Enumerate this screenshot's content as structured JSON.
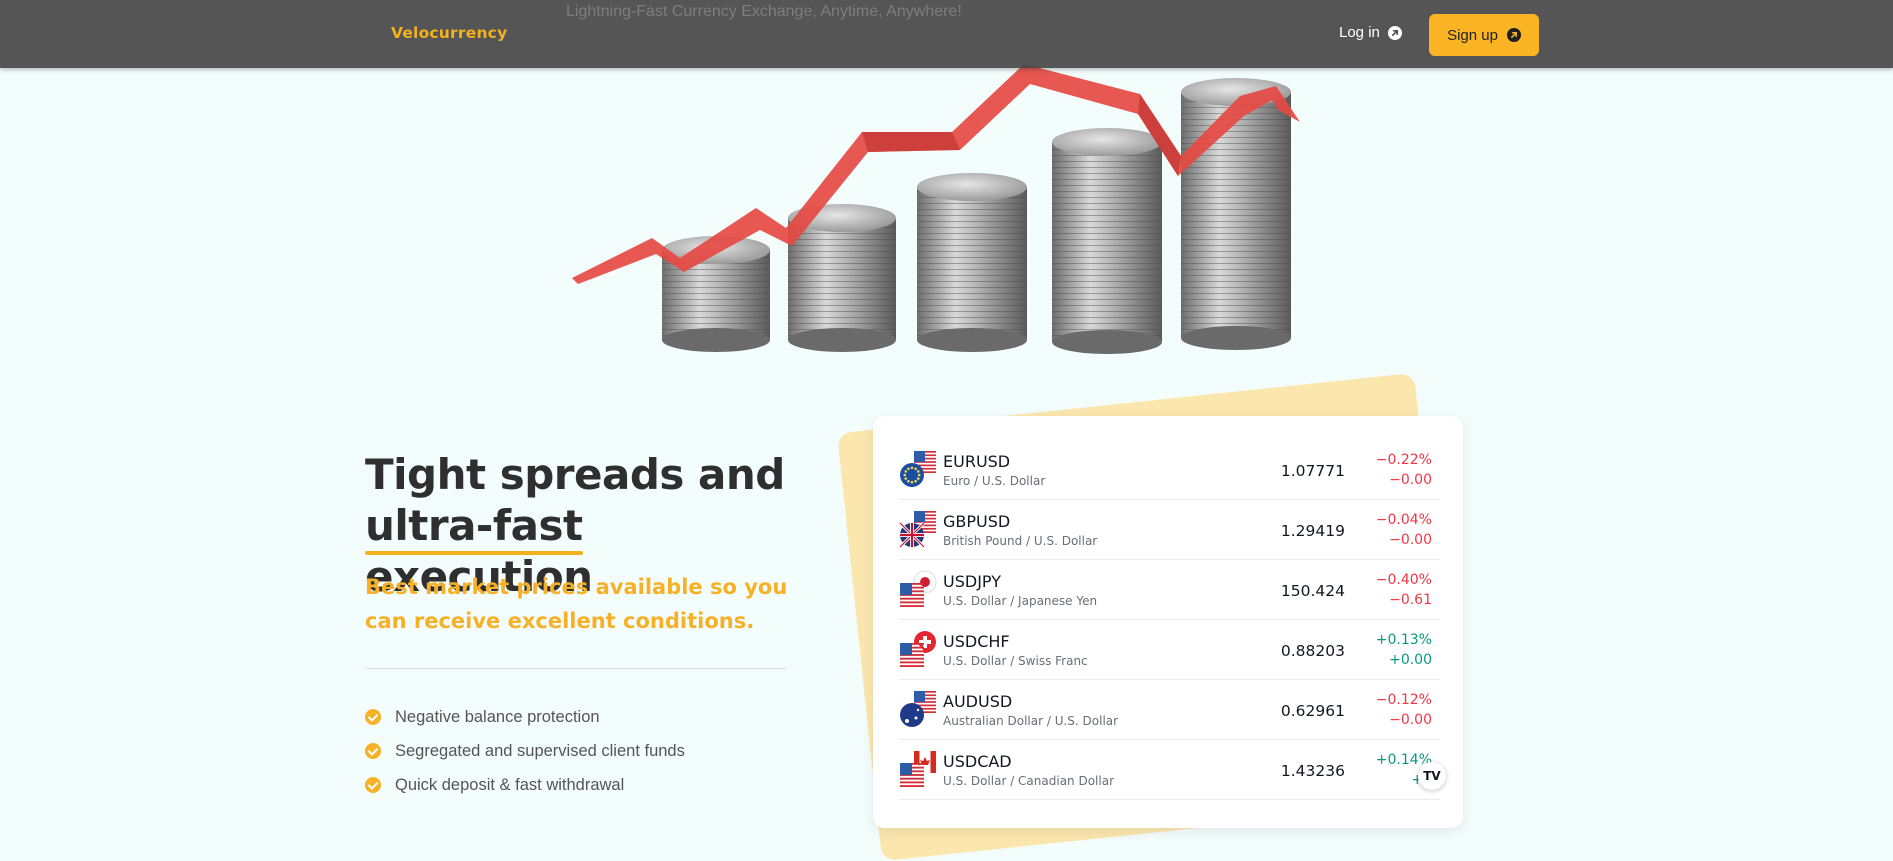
{
  "header": {
    "brand": "Velocurrency",
    "tagline": "Lightning-Fast Currency Exchange, Anytime, Anywhere!",
    "login_label": "Log in",
    "signup_label": "Sign up",
    "accent_color": "#f4b11e",
    "bar_color": "#484848"
  },
  "hero": {
    "headline_line1": "Tight spreads and",
    "headline_underlined": "ultra-fast",
    "headline_rest": "execution",
    "subhead": "Best market prices available so you can receive excellent conditions.",
    "features": [
      "Negative balance protection",
      "Segregated and supervised client funds",
      "Quick deposit & fast withdrawal"
    ]
  },
  "ticker": {
    "rows": [
      {
        "symbol": "EURUSD",
        "name": "Euro / U.S. Dollar",
        "price": "1.07771",
        "percent": "−0.22%",
        "change": "−0.00",
        "direction": "down",
        "base_flag": "eu-flag-icon"
      },
      {
        "symbol": "GBPUSD",
        "name": "British Pound / U.S. Dollar",
        "price": "1.29419",
        "percent": "−0.04%",
        "change": "−0.00",
        "direction": "down",
        "base_flag": "uk-flag-icon"
      },
      {
        "symbol": "USDJPY",
        "name": "U.S. Dollar / Japanese Yen",
        "price": "150.424",
        "percent": "−0.40%",
        "change": "−0.61",
        "direction": "down",
        "base_flag": "us-flag-icon"
      },
      {
        "symbol": "USDCHF",
        "name": "U.S. Dollar / Swiss Franc",
        "price": "0.88203",
        "percent": "+0.13%",
        "change": "+0.00",
        "direction": "up",
        "base_flag": "us-flag-icon"
      },
      {
        "symbol": "AUDUSD",
        "name": "Australian Dollar / U.S. Dollar",
        "price": "0.62961",
        "percent": "−0.12%",
        "change": "−0.00",
        "direction": "down",
        "base_flag": "au-flag-icon"
      },
      {
        "symbol": "USDCAD",
        "name": "U.S. Dollar / Canadian Dollar",
        "price": "1.43236",
        "percent": "+0.14%",
        "change": "+0",
        "direction": "up",
        "base_flag": "us-flag-icon"
      }
    ],
    "negative_color": "#f23645",
    "positive_color": "#089981",
    "badge_text": "TV"
  }
}
